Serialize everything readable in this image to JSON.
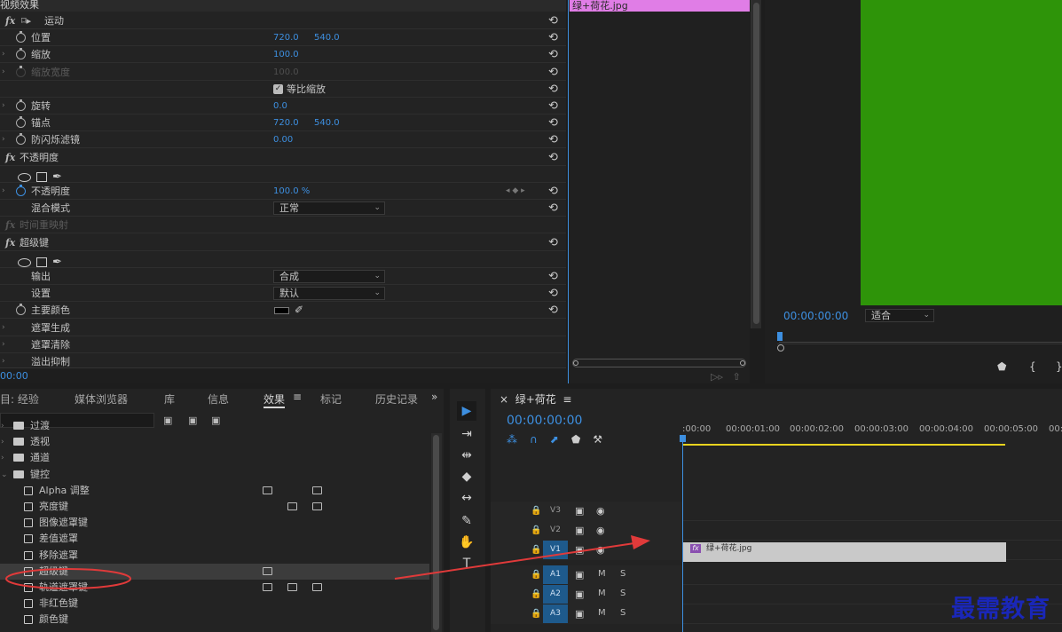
{
  "effect_controls": {
    "header": "视频效果",
    "time": "00:00",
    "rows": [
      {
        "type": "group",
        "label": "运动"
      },
      {
        "type": "param",
        "label": "位置",
        "v1": "720.0",
        "v2": "540.0"
      },
      {
        "type": "param",
        "label": "缩放",
        "v1": "100.0",
        "expand": true
      },
      {
        "type": "param",
        "label": "缩放宽度",
        "v1": "100.0",
        "disabled": true,
        "expand": true
      },
      {
        "type": "checkbox",
        "label": "等比缩放"
      },
      {
        "type": "param",
        "label": "旋转",
        "v1": "0.0",
        "expand": true
      },
      {
        "type": "param",
        "label": "锚点",
        "v1": "720.0",
        "v2": "540.0"
      },
      {
        "type": "param",
        "label": "防闪烁滤镜",
        "v1": "0.00",
        "expand": true
      },
      {
        "type": "group",
        "label": "不透明度"
      },
      {
        "type": "shapes"
      },
      {
        "type": "param",
        "label": "不透明度",
        "v1": "100.0 %",
        "expand": true,
        "keyframed": true
      },
      {
        "type": "dropdown",
        "label": "混合模式",
        "value": "正常"
      },
      {
        "type": "group",
        "label": "时间重映射",
        "dim": true
      },
      {
        "type": "group",
        "label": "超级键"
      },
      {
        "type": "shapes"
      },
      {
        "type": "dropdown",
        "label": "输出",
        "value": "合成"
      },
      {
        "type": "dropdown",
        "label": "设置",
        "value": "默认"
      },
      {
        "type": "color",
        "label": "主要颜色"
      },
      {
        "type": "sub",
        "label": "遮罩生成"
      },
      {
        "type": "sub",
        "label": "遮罩清除"
      },
      {
        "type": "sub",
        "label": "溢出抑制"
      }
    ],
    "clip_name": "绿+荷花.jpg"
  },
  "monitor": {
    "timecode": "00:00:00:00",
    "fit": "适合",
    "frame_color": "#2e9409"
  },
  "project_panel": {
    "tabs": [
      "目: 经验",
      "媒体浏览器",
      "库",
      "信息",
      "效果",
      "标记",
      "历史记录"
    ],
    "active_tab": "效果",
    "tree": [
      {
        "kind": "folder",
        "label": "过渡",
        "level": 0
      },
      {
        "kind": "folder",
        "label": "透视",
        "level": 0
      },
      {
        "kind": "folder",
        "label": "通道",
        "level": 0
      },
      {
        "kind": "folder",
        "label": "键控",
        "level": 0,
        "open": true
      },
      {
        "kind": "item",
        "label": "Alpha 调整"
      },
      {
        "kind": "item",
        "label": "亮度键"
      },
      {
        "kind": "item",
        "label": "图像遮罩键"
      },
      {
        "kind": "item",
        "label": "差值遮罩"
      },
      {
        "kind": "item",
        "label": "移除遮罩"
      },
      {
        "kind": "item",
        "label": "超级键",
        "selected": true
      },
      {
        "kind": "item",
        "label": "轨道遮罩键"
      },
      {
        "kind": "item",
        "label": "非红色键"
      },
      {
        "kind": "item",
        "label": "颜色键"
      }
    ]
  },
  "timeline": {
    "sequence_name": "绿+荷花",
    "timecode": "00:00:00:00",
    "ruler": [
      ":00:00",
      "00:00:01:00",
      "00:00:02:00",
      "00:00:03:00",
      "00:00:04:00",
      "00:00:05:00",
      "00:0"
    ],
    "tracks": [
      {
        "name": "V3"
      },
      {
        "name": "V2"
      },
      {
        "name": "V1",
        "hl": true
      },
      {
        "name": "A1",
        "audio": true
      },
      {
        "name": "A2",
        "audio": true
      },
      {
        "name": "A3",
        "audio": true
      }
    ],
    "clip": {
      "label": "绿+荷花.jpg",
      "track": "V1"
    }
  },
  "watermark": "最需教育",
  "colors": {
    "accent": "#3d8fe0",
    "annotation_red": "#e03a3a",
    "clip_pink": "#e07de6"
  }
}
